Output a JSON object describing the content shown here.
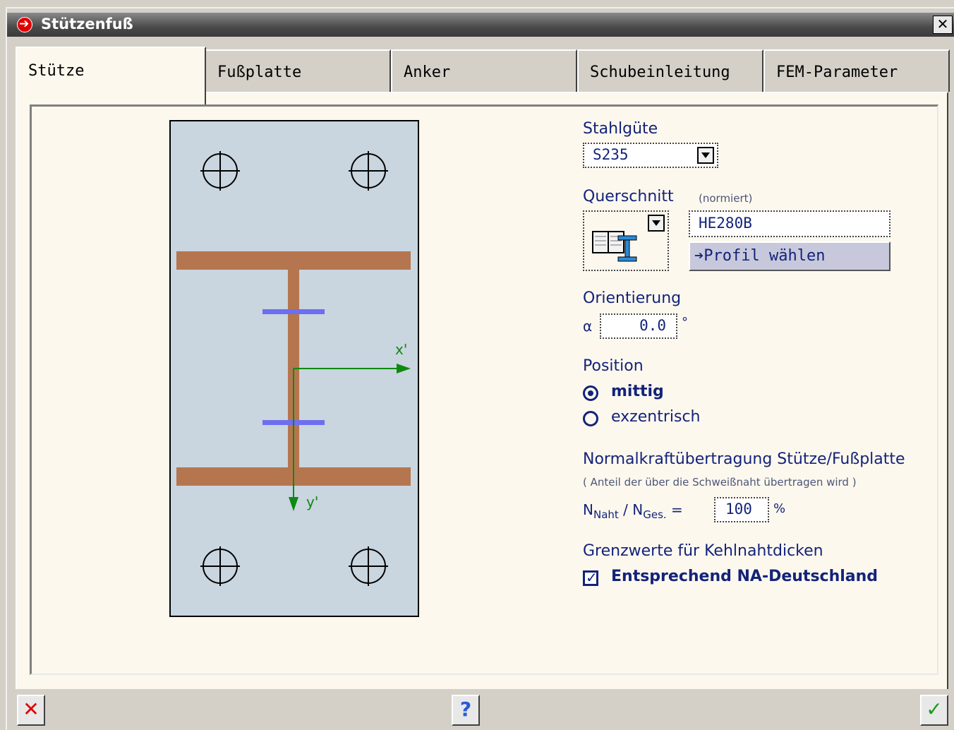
{
  "window": {
    "title": "Stützenfuß"
  },
  "tabs": [
    {
      "label": "Stütze",
      "active": true
    },
    {
      "label": "Fußplatte"
    },
    {
      "label": "Anker"
    },
    {
      "label": "Schubeinleitung"
    },
    {
      "label": "FEM-Parameter"
    }
  ],
  "drawing": {
    "axis_x": "x'",
    "axis_y": "y'"
  },
  "stahlguete": {
    "label": "Stahlgüte",
    "value": "S235"
  },
  "querschnitt": {
    "label": "Querschnitt",
    "note": "(normiert)",
    "value": "HE280B",
    "button_label": "Profil wählen"
  },
  "orientierung": {
    "label": "Orientierung",
    "symbol": "α",
    "value": "0.0",
    "unit": "°"
  },
  "position": {
    "label": "Position",
    "options": [
      "mittig",
      "exzentrisch"
    ],
    "selected": "mittig"
  },
  "normalkraft": {
    "label": "Normalkraftübertragung Stütze/Fußplatte",
    "note": "( Anteil der über die Schweißnaht übertragen wird )",
    "formula_n1": "N",
    "formula_sub1": "Naht",
    "formula_sep": "/",
    "formula_n2": "N",
    "formula_sub2": "Ges.",
    "formula_eq": "=",
    "value": "100",
    "unit": "%"
  },
  "grenzwerte": {
    "label": "Grenzwerte für Kehlnahtdicken",
    "checkbox_label": "Entsprechend NA-Deutschland",
    "checked": true
  },
  "colors": {
    "plate": "#c9d5df",
    "profile": "#b5764f",
    "stiffener": "#6e6ef0",
    "axis": "#0e8a0e",
    "label": "#13237a"
  }
}
